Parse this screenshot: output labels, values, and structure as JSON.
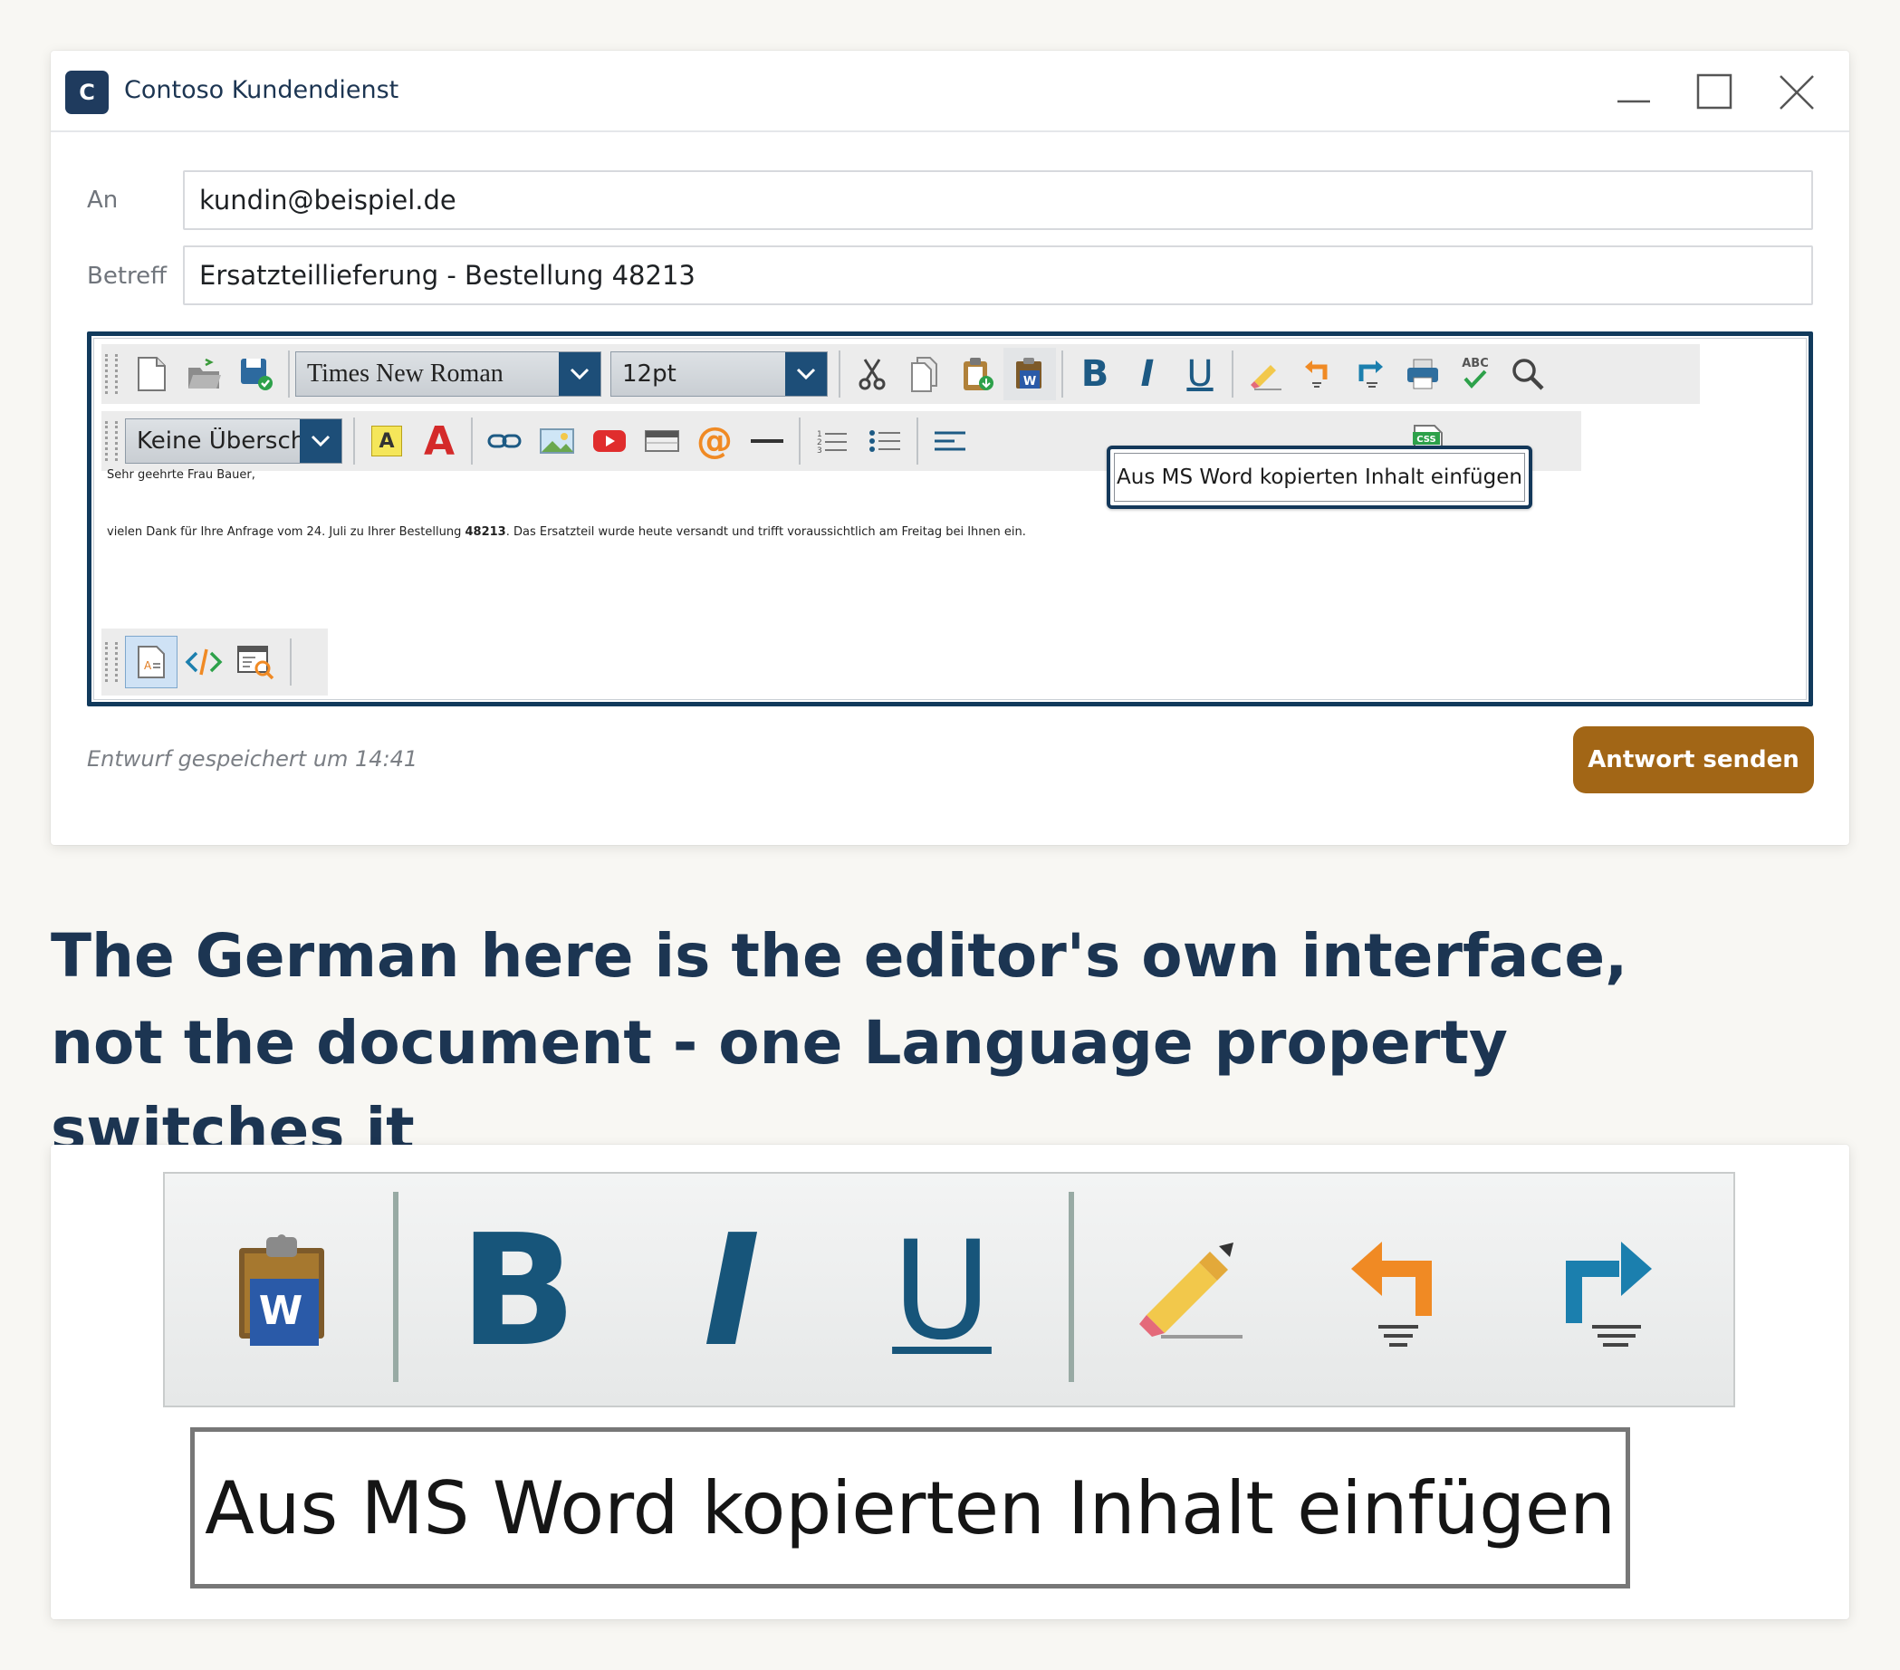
{
  "window": {
    "app_icon_letter": "C",
    "title": "Contoso Kundendienst"
  },
  "form": {
    "to_label": "An",
    "to_value": "kundin@beispiel.de",
    "subject_label": "Betreff",
    "subject_value": "Ersatzteillieferung - Bestellung 48213"
  },
  "editor": {
    "font_family_value": "Times New Roman",
    "font_size_value": "12pt",
    "heading_value": "Keine Überschrift",
    "tooltip": "Aus MS Word kopierten Inhalt einfügen",
    "spellcheck_icon_text": "ABC",
    "css_icon_text": "CSS",
    "word_icon_text": "W",
    "highlight_icon_text": "A",
    "fontcolor_icon_text": "A",
    "bold_icon_text": "B",
    "italic_icon_text": "I",
    "underline_icon_text": "U",
    "document": {
      "greeting": "Sehr geehrte Frau Bauer,",
      "body_before": "vielen Dank für Ihre Anfrage vom 24. Juli zu Ihrer Bestellung ",
      "body_bold": "48213",
      "body_after": ". Das Ersatzteil wurde heute versandt und trifft voraussichtlich am Freitag bei Ihnen ein."
    }
  },
  "footer": {
    "status": "Entwurf gespeichert um 14:41",
    "send_button": "Antwort senden"
  },
  "caption": "The German here is the editor's own interface, not the document - one Language property switches it",
  "zoom": {
    "word_icon_text": "W",
    "bold_icon_text": "B",
    "italic_icon_text": "I",
    "underline_icon_text": "U",
    "tooltip": "Aus MS Word kopierten Inhalt einfügen"
  },
  "colors": {
    "brand": "#1f3b5e",
    "editor_border": "#113a5c",
    "send_button": "#a26616",
    "accent_blue": "#1d5a84",
    "accent_orange": "#f08a24"
  }
}
